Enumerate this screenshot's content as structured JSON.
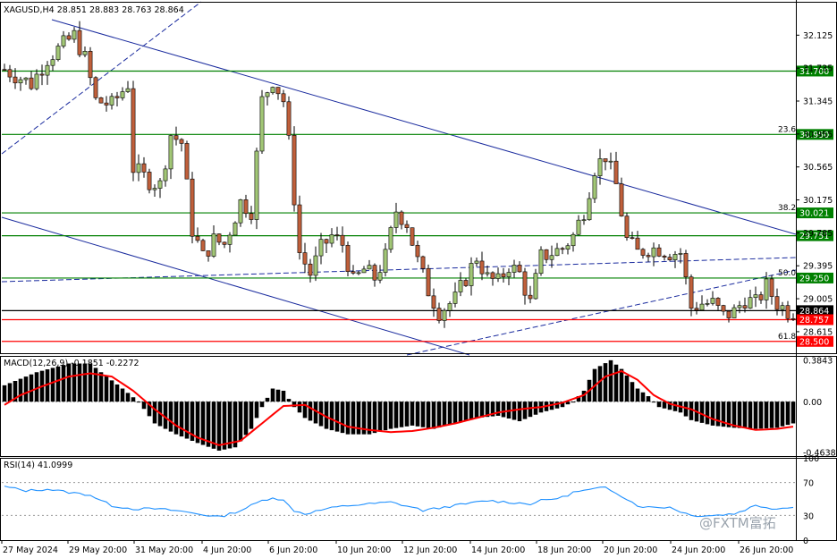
{
  "chart_data": [
    {
      "type": "candlestick",
      "title": "XAGUSD,H4  28.851 28.883 28.763 28.864",
      "symbol": "XAGUSD",
      "timeframe": "H4",
      "ylim": [
        28.36,
        32.52
      ],
      "y_ticks": [
        "32.125",
        "31.735",
        "31.345",
        "30.955",
        "30.565",
        "30.175",
        "29.785",
        "29.395",
        "29.005",
        "28.615"
      ],
      "x_ticks": [
        "27 May 2024",
        "29 May 20:00",
        "31 May 20:00",
        "4 Jun 20:00",
        "6 Jun 20:00",
        "10 Jun 20:00",
        "12 Jun 20:00",
        "14 Jun 20:00",
        "18 Jun 20:00",
        "20 Jun 20:00",
        "24 Jun 20:00",
        "26 Jun 20:00"
      ],
      "n_bars": 148,
      "bull_color": "#a2c776",
      "bear_color": "#c0603b",
      "close_path": [
        [
          0,
          31.72
        ],
        [
          5,
          31.55
        ],
        [
          8,
          31.85
        ],
        [
          13,
          32.12
        ],
        [
          15,
          31.85
        ],
        [
          17,
          31.35
        ],
        [
          20,
          31.3
        ],
        [
          23,
          31.55
        ],
        [
          24,
          30.55
        ],
        [
          27,
          30.4
        ],
        [
          29,
          30.35
        ],
        [
          31,
          30.95
        ],
        [
          33,
          30.85
        ],
        [
          35,
          29.82
        ],
        [
          37,
          29.5
        ],
        [
          39,
          29.7
        ],
        [
          41,
          29.65
        ],
        [
          44,
          30.15
        ],
        [
          46,
          30.05
        ],
        [
          48,
          31.35
        ],
        [
          50,
          31.6
        ],
        [
          52,
          31.35
        ],
        [
          53,
          30.85
        ],
        [
          55,
          29.55
        ],
        [
          57,
          29.3
        ],
        [
          59,
          29.6
        ],
        [
          61,
          29.75
        ],
        [
          63,
          29.65
        ],
        [
          65,
          29.2
        ],
        [
          67,
          29.35
        ],
        [
          69,
          29.25
        ],
        [
          71,
          29.5
        ],
        [
          73,
          30.05
        ],
        [
          75,
          29.9
        ],
        [
          77,
          29.45
        ],
        [
          79,
          29.1
        ],
        [
          81,
          28.85
        ],
        [
          84,
          29.0
        ],
        [
          86,
          29.25
        ],
        [
          88,
          29.5
        ],
        [
          90,
          29.25
        ],
        [
          92,
          29.2
        ],
        [
          94,
          29.4
        ],
        [
          96,
          29.3
        ],
        [
          98,
          28.95
        ],
        [
          100,
          29.5
        ],
        [
          102,
          29.55
        ],
        [
          104,
          29.6
        ],
        [
          106,
          29.75
        ],
        [
          108,
          30.05
        ],
        [
          110,
          30.55
        ],
        [
          112,
          30.7
        ],
        [
          114,
          30.35
        ],
        [
          116,
          29.7
        ],
        [
          118,
          29.55
        ],
        [
          120,
          29.6
        ],
        [
          122,
          29.6
        ],
        [
          124,
          29.55
        ],
        [
          126,
          29.55
        ],
        [
          128,
          28.9
        ],
        [
          130,
          28.95
        ],
        [
          132,
          28.95
        ],
        [
          134,
          28.8
        ],
        [
          136,
          28.85
        ],
        [
          138,
          29.0
        ],
        [
          140,
          28.95
        ],
        [
          142,
          29.15
        ],
        [
          144,
          28.95
        ],
        [
          146,
          28.86
        ],
        [
          147,
          28.86
        ]
      ],
      "horizontal_levels": [
        {
          "value": 31.7,
          "label": "31.700",
          "color": "#008000"
        },
        {
          "value": 30.95,
          "label": "30.950",
          "color": "#008000"
        },
        {
          "value": 30.021,
          "label": "30.021",
          "color": "#008000"
        },
        {
          "value": 29.751,
          "label": "29.751",
          "color": "#008000"
        },
        {
          "value": 29.25,
          "label": "29.250",
          "color": "#008000"
        },
        {
          "value": 28.864,
          "label": "28.864",
          "color": "#000000"
        },
        {
          "value": 28.757,
          "label": "28.757",
          "color": "#ff0000"
        },
        {
          "value": 28.5,
          "label": "28.500",
          "color": "#ff0000"
        }
      ],
      "fibonacci_labels": [
        {
          "text": "23.6",
          "value": 30.95
        },
        {
          "text": "38.2",
          "value": 30.021
        },
        {
          "text": "50.0",
          "value": 29.25
        },
        {
          "text": "61.8",
          "value": 28.5
        }
      ]
    },
    {
      "type": "bar",
      "title": "MACD(12,26,9) -0.1851 -0.2272",
      "ylim": [
        -0.5,
        0.42
      ],
      "y_ticks": [
        "0.3843",
        "0.00",
        "-0.4638"
      ],
      "bar_color": "#000000",
      "signal_color": "#ff0000",
      "histogram_path": [
        [
          0,
          0.15
        ],
        [
          6,
          0.27
        ],
        [
          12,
          0.35
        ],
        [
          16,
          0.35
        ],
        [
          18,
          0.27
        ],
        [
          22,
          0.12
        ],
        [
          25,
          0.0
        ],
        [
          28,
          -0.2
        ],
        [
          32,
          -0.3
        ],
        [
          36,
          -0.38
        ],
        [
          40,
          -0.45
        ],
        [
          43,
          -0.42
        ],
        [
          46,
          -0.25
        ],
        [
          48,
          -0.05
        ],
        [
          50,
          0.12
        ],
        [
          52,
          0.1
        ],
        [
          54,
          -0.05
        ],
        [
          56,
          -0.15
        ],
        [
          60,
          -0.25
        ],
        [
          64,
          -0.3
        ],
        [
          68,
          -0.3
        ],
        [
          72,
          -0.25
        ],
        [
          76,
          -0.22
        ],
        [
          80,
          -0.25
        ],
        [
          84,
          -0.2
        ],
        [
          88,
          -0.15
        ],
        [
          92,
          -0.13
        ],
        [
          96,
          -0.18
        ],
        [
          100,
          -0.1
        ],
        [
          104,
          -0.05
        ],
        [
          106,
          0.0
        ],
        [
          108,
          0.1
        ],
        [
          110,
          0.3
        ],
        [
          113,
          0.38
        ],
        [
          115,
          0.3
        ],
        [
          118,
          0.12
        ],
        [
          120,
          0.05
        ],
        [
          122,
          -0.05
        ],
        [
          126,
          -0.1
        ],
        [
          128,
          -0.17
        ],
        [
          132,
          -0.22
        ],
        [
          136,
          -0.24
        ],
        [
          140,
          -0.25
        ],
        [
          144,
          -0.24
        ],
        [
          147,
          -0.2
        ]
      ],
      "signal_path": [
        [
          0,
          -0.03
        ],
        [
          3,
          0.06
        ],
        [
          7,
          0.14
        ],
        [
          12,
          0.23
        ],
        [
          16,
          0.26
        ],
        [
          20,
          0.23
        ],
        [
          24,
          0.1
        ],
        [
          28,
          -0.07
        ],
        [
          32,
          -0.22
        ],
        [
          36,
          -0.33
        ],
        [
          40,
          -0.4
        ],
        [
          44,
          -0.36
        ],
        [
          48,
          -0.2
        ],
        [
          52,
          -0.04
        ],
        [
          56,
          -0.03
        ],
        [
          60,
          -0.14
        ],
        [
          64,
          -0.23
        ],
        [
          68,
          -0.26
        ],
        [
          72,
          -0.28
        ],
        [
          76,
          -0.27
        ],
        [
          80,
          -0.24
        ],
        [
          84,
          -0.2
        ],
        [
          88,
          -0.15
        ],
        [
          92,
          -0.1
        ],
        [
          96,
          -0.07
        ],
        [
          100,
          -0.05
        ],
        [
          104,
          -0.01
        ],
        [
          108,
          0.06
        ],
        [
          112,
          0.23
        ],
        [
          115,
          0.28
        ],
        [
          118,
          0.2
        ],
        [
          121,
          0.06
        ],
        [
          124,
          -0.02
        ],
        [
          128,
          -0.07
        ],
        [
          132,
          -0.16
        ],
        [
          136,
          -0.22
        ],
        [
          140,
          -0.26
        ],
        [
          144,
          -0.25
        ],
        [
          147,
          -0.23
        ]
      ]
    },
    {
      "type": "line",
      "title": "RSI(14) 41.0999",
      "ylim": [
        0,
        100
      ],
      "y_ticks": [
        "100",
        "70",
        "30",
        "0"
      ],
      "levels": [
        70,
        30
      ],
      "line_color": "#1e90ff",
      "rsi_path": [
        [
          0,
          65
        ],
        [
          4,
          60
        ],
        [
          8,
          62
        ],
        [
          12,
          58
        ],
        [
          16,
          55
        ],
        [
          18,
          48
        ],
        [
          20,
          42
        ],
        [
          24,
          38
        ],
        [
          28,
          38
        ],
        [
          32,
          36
        ],
        [
          36,
          32
        ],
        [
          40,
          28
        ],
        [
          44,
          36
        ],
        [
          48,
          48
        ],
        [
          50,
          52
        ],
        [
          52,
          48
        ],
        [
          54,
          36
        ],
        [
          56,
          32
        ],
        [
          60,
          38
        ],
        [
          64,
          42
        ],
        [
          68,
          44
        ],
        [
          72,
          46
        ],
        [
          76,
          40
        ],
        [
          78,
          36
        ],
        [
          82,
          40
        ],
        [
          86,
          44
        ],
        [
          90,
          48
        ],
        [
          94,
          46
        ],
        [
          98,
          44
        ],
        [
          100,
          48
        ],
        [
          104,
          52
        ],
        [
          106,
          58
        ],
        [
          110,
          62
        ],
        [
          112,
          64
        ],
        [
          114,
          58
        ],
        [
          118,
          42
        ],
        [
          120,
          40
        ],
        [
          124,
          40
        ],
        [
          128,
          30
        ],
        [
          132,
          30
        ],
        [
          136,
          32
        ],
        [
          140,
          42
        ],
        [
          144,
          38
        ],
        [
          147,
          41
        ]
      ]
    }
  ],
  "watermark": "@FXTM富拓"
}
